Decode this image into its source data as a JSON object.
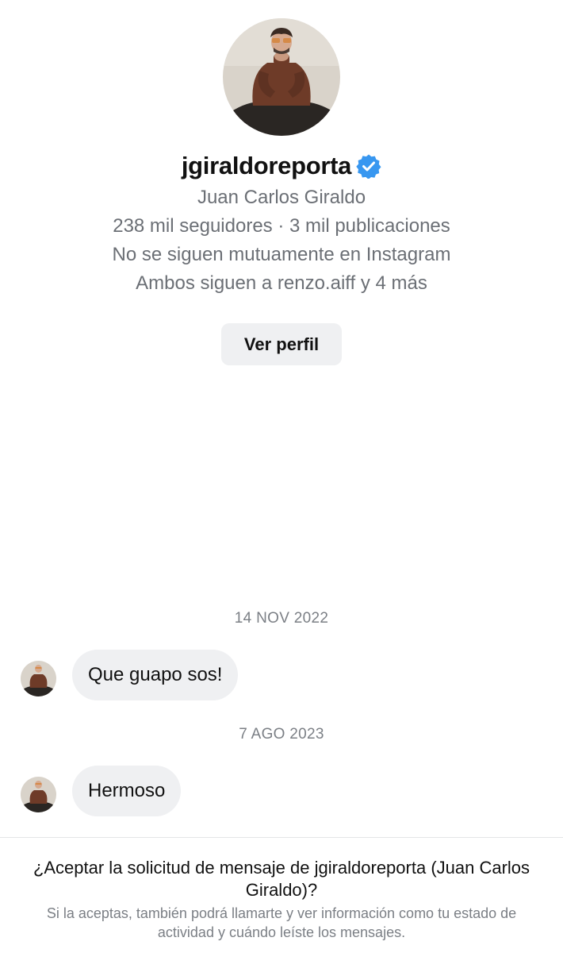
{
  "profile": {
    "username": "jgiraldoreporta",
    "verified_icon": "verified-badge-icon",
    "full_name": "Juan Carlos Giraldo",
    "stats": "238 mil seguidores · 3 mil publicaciones",
    "mutual_status": "No se siguen mutuamente en Instagram",
    "mutual_followers": "Ambos siguen a renzo.aiff y 4 más",
    "view_profile_label": "Ver perfil",
    "avatar_icon": "profile-photo"
  },
  "conversation": [
    {
      "date": "14 NOV 2022",
      "message": "Que guapo sos!"
    },
    {
      "date": "7 AGO 2023",
      "message": "Hermoso"
    }
  ],
  "request": {
    "title": "¿Aceptar la solicitud de mensaje de jgiraldoreporta (Juan Carlos Giraldo)?",
    "subtitle": "Si la aceptas, también podrá llamarte y ver información como tu estado de actividad y cuándo leíste los mensajes."
  },
  "colors": {
    "verified_blue": "#3897f0",
    "bubble_background": "#eff0f2",
    "secondary_text": "#6b6f75"
  }
}
